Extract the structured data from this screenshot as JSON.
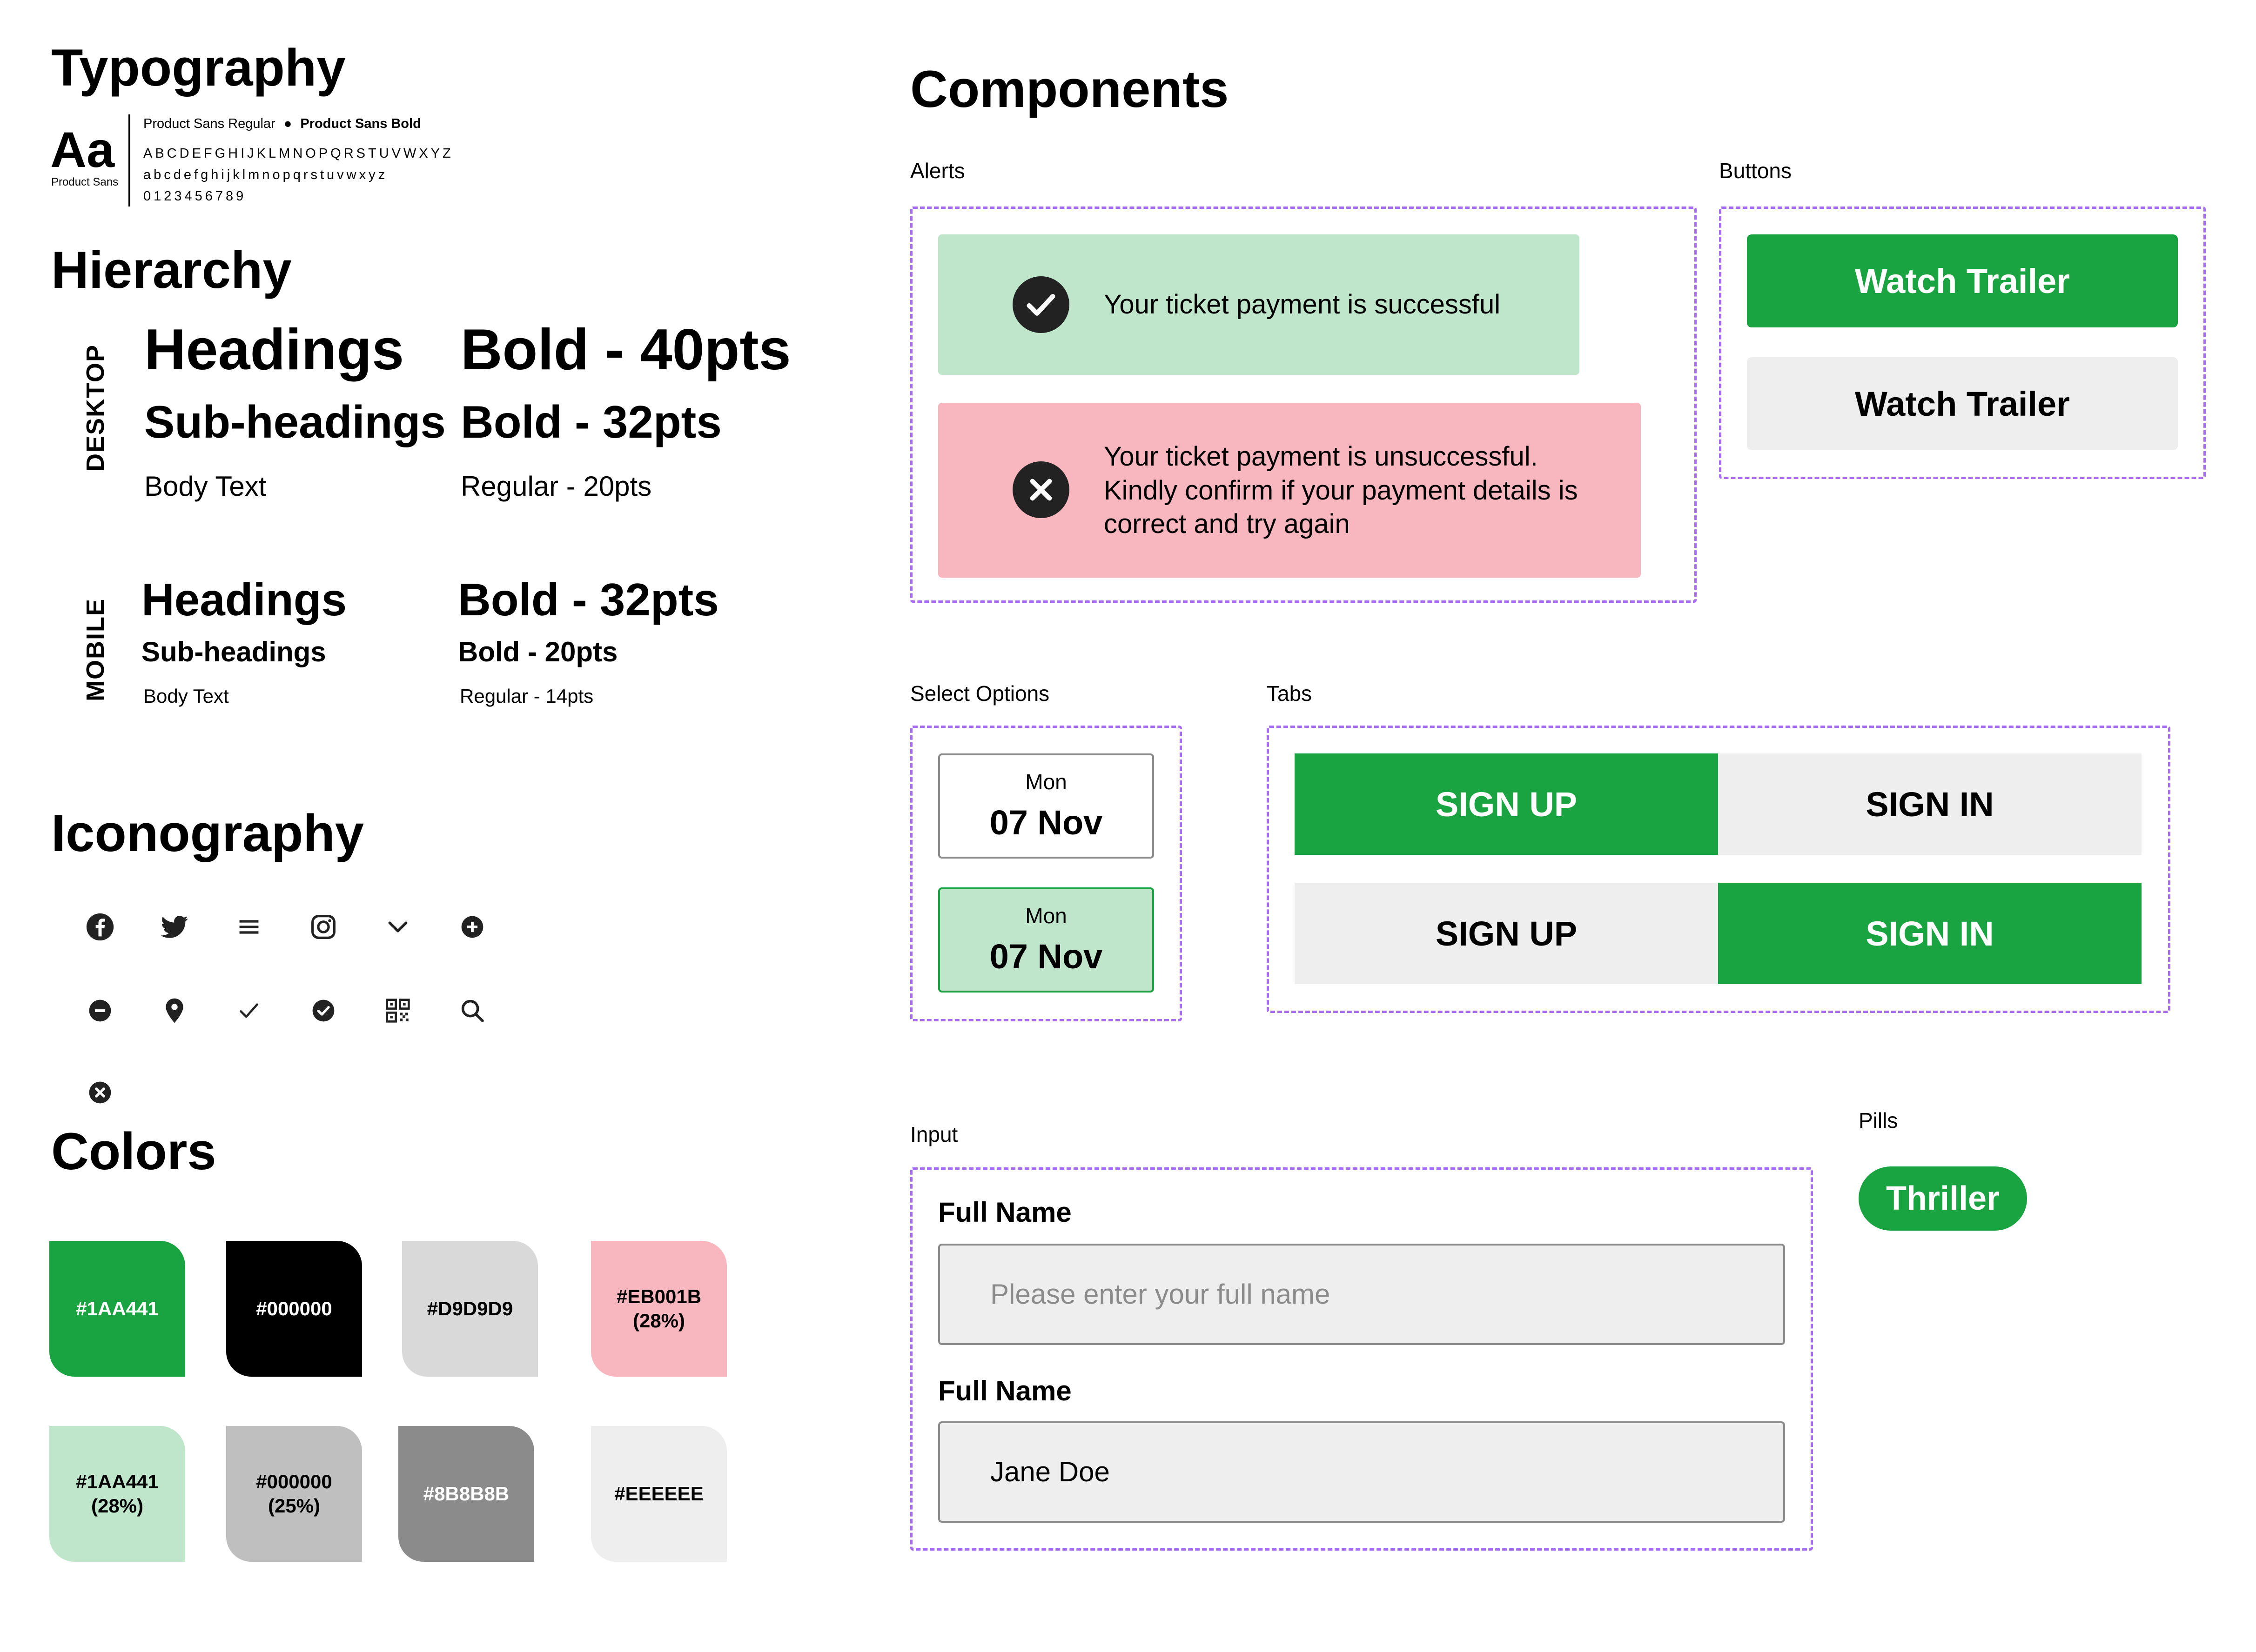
{
  "typography": {
    "title": "Typography",
    "sample_glyph": "Aa",
    "sample_caption": "Product Sans",
    "font_regular": "Product Sans Regular",
    "bullet": "●",
    "font_bold": "Product Sans Bold",
    "uppercase": "ABCDEFGHIJKLMNOPQRSTUVWXYZ",
    "lowercase": "abcdefghijklmnopqrstuvwxyz",
    "digits": "0123456789"
  },
  "hierarchy": {
    "title": "Hierarchy",
    "desktop": {
      "label": "DESKTOP",
      "headings": "Headings",
      "headings_spec": "Bold - 40pts",
      "subheadings": "Sub-headings",
      "subheadings_spec": "Bold - 32pts",
      "body": "Body Text",
      "body_spec": "Regular - 20pts"
    },
    "mobile": {
      "label": "MOBILE",
      "headings": "Headings",
      "headings_spec": "Bold - 32pts",
      "subheadings": "Sub-headings",
      "subheadings_spec": "Bold - 20pts",
      "body": "Body Text",
      "body_spec": "Regular - 14pts"
    }
  },
  "iconography": {
    "title": "Iconography",
    "icons": [
      "facebook-icon",
      "twitter-icon",
      "menu-icon",
      "instagram-icon",
      "chevron-down-icon",
      "plus-circle-icon",
      "minus-circle-icon",
      "location-pin-icon",
      "check-icon",
      "check-circle-icon",
      "qr-code-icon",
      "search-icon",
      "close-circle-icon"
    ]
  },
  "colors": {
    "title": "Colors",
    "swatches": [
      {
        "label": "#1AA441",
        "bg": "#1AA441",
        "fg": "#ffffff"
      },
      {
        "label": "#000000",
        "bg": "#000000",
        "fg": "#ffffff"
      },
      {
        "label": "#D9D9D9",
        "bg": "#D9D9D9",
        "fg": "#000000"
      },
      {
        "label": "#EB001B\n(28%)",
        "bg": "#F8B6BE",
        "fg": "#000000"
      },
      {
        "label": "#1AA441\n(28%)",
        "bg": "#BFE6CB",
        "fg": "#000000"
      },
      {
        "label": "#000000\n(25%)",
        "bg": "#BFBFBF",
        "fg": "#000000"
      },
      {
        "label": "#8B8B8B",
        "bg": "#8B8B8B",
        "fg": "#ffffff"
      },
      {
        "label": "#EEEEEE",
        "bg": "#EEEEEE",
        "fg": "#000000"
      }
    ]
  },
  "components": {
    "title": "Components",
    "alerts": {
      "label": "Alerts",
      "success": "Your ticket payment is successful",
      "error": "Your ticket payment is unsuccessful. Kindly confirm if your payment details is correct and try again"
    },
    "buttons": {
      "label": "Buttons",
      "primary": "Watch Trailer",
      "secondary": "Watch Trailer"
    },
    "select_options": {
      "label": "Select Options",
      "options": [
        {
          "day": "Mon",
          "date": "07 Nov",
          "selected": false
        },
        {
          "day": "Mon",
          "date": "07 Nov",
          "selected": true
        }
      ]
    },
    "tabs": {
      "label": "Tabs",
      "rows": [
        {
          "left": "SIGN UP",
          "right": "SIGN IN",
          "active": "left"
        },
        {
          "left": "SIGN UP",
          "right": "SIGN IN",
          "active": "right"
        }
      ]
    },
    "input": {
      "label": "Input",
      "field1_label": "Full Name",
      "field1_placeholder": "Please enter your full name",
      "field2_label": "Full Name",
      "field2_value": "Jane Doe"
    },
    "pills": {
      "label": "Pills",
      "pill": "Thriller"
    }
  },
  "palette": {
    "green": "#1AA441",
    "green_light": "#BFE6CB",
    "red_light": "#F8B6BE",
    "grey_light": "#EEEEEE",
    "border_dashed": "#A66BF2",
    "dark": "#222222"
  }
}
